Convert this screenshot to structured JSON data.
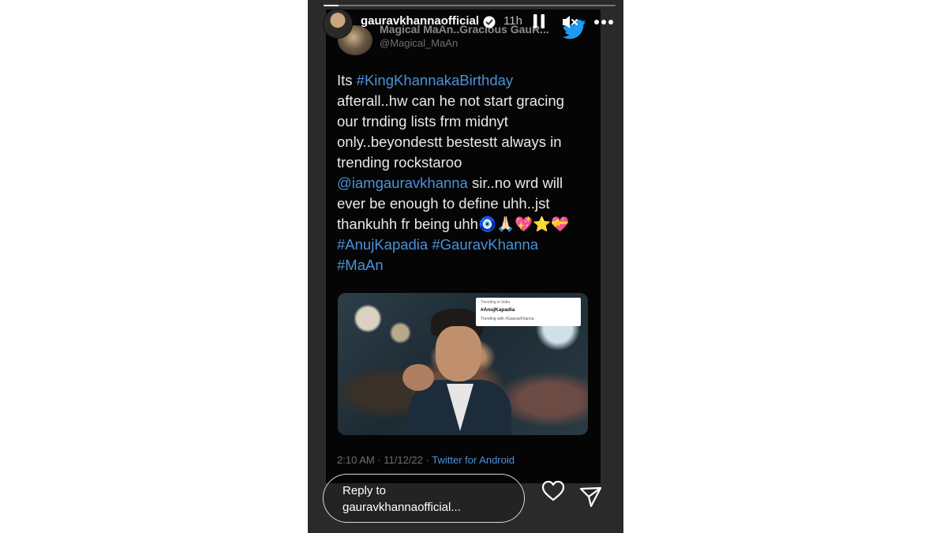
{
  "story": {
    "username": "gauravkhannaofficial",
    "time": "11h",
    "progress": 0.05,
    "reply_placeholder": "Reply to\ngauravkhannaofficial...",
    "icons": [
      "pause-icon",
      "mute-icon",
      "more-icon",
      "verified-icon",
      "heart-icon",
      "share-icon"
    ]
  },
  "tweet": {
    "author_name": "Magical MaAn..Gracious GauR...",
    "handle": "@Magical_MaAn",
    "text_parts": [
      "Its ",
      "#KingKhannakaBirthday",
      "\nafterall..hw can he not start gracing\nour trnding lists frm midnyt\nonly..beyondestt bestestt always in\ntrending rockstaroo\n",
      "@iamgauravkhanna",
      " sir..no wrd will\never be enough to define uhh..jst\nthankuhh fr being uhh🧿🙏🏻💖⭐💝\n",
      "#AnujKapadia #GauravKhanna\n#MaAn"
    ],
    "image": {
      "trend_label": "Trending in India",
      "trend_topic": "#AnujKapadia",
      "trend_with": "Trending with #GauravKhanna"
    },
    "footer_time": "2:10 AM · 11/12/22 · ",
    "footer_source": "Twitter for Android"
  },
  "colors": {
    "link": "#4a92d8",
    "card_bg": "#050505",
    "frame_bg": "#2a2a2a",
    "twitter_blue": "#1d9bf0"
  }
}
